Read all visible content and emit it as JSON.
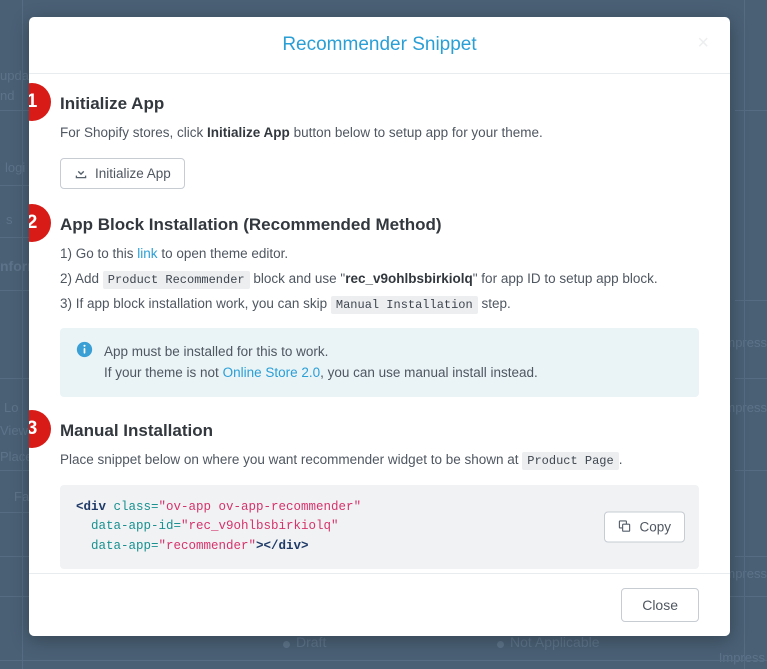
{
  "background": {
    "status_draft": "Draft",
    "status_not_applicable": "Not Applicable",
    "fragments": [
      "upda",
      "nd",
      "logi",
      "s",
      "nform",
      "Lo",
      "View",
      "Place",
      "Fa",
      "licable"
    ],
    "right_fragments": [
      "mpress",
      "mpress",
      "mpress",
      "Impress"
    ]
  },
  "modal": {
    "title": "Recommender Snippet",
    "close_icon": "×",
    "footer": {
      "close_label": "Close"
    },
    "sections": [
      {
        "badge": "1",
        "title": "Initialize App",
        "desc_before": "For Shopify stores, click ",
        "desc_bold": "Initialize App",
        "desc_after": " button below to setup app for your theme.",
        "button_label": "Initialize App",
        "button_icon": "download-icon"
      },
      {
        "badge": "2",
        "title": "App Block Installation (Recommended Method)",
        "step1_before": "1) Go to this ",
        "step1_link": "link",
        "step1_after": " to open theme editor.",
        "step2_before": "2) Add ",
        "step2_chip": "Product Recommender",
        "step2_middle": " block and use \"",
        "step2_appid": "rec_v9ohlbsbirkiolq",
        "step2_after": "\" for app ID to setup app block.",
        "step3_before": "3) If app block installation work, you can skip ",
        "step3_chip": "Manual Installation",
        "step3_after": " step.",
        "alert": {
          "icon": "info-icon",
          "line1": "App must be installed for this to work.",
          "line2_before": "If your theme is not ",
          "line2_link": "Online Store 2.0",
          "line2_after": ", you can use manual install instead."
        }
      },
      {
        "badge": "3",
        "title": "Manual Installation",
        "desc_before": "Place snippet below on where you want recommender widget to be shown at ",
        "desc_chip": "Product Page",
        "desc_after": ".",
        "copy_label": "Copy",
        "copy_icon": "copy-icon",
        "code": {
          "line1_tag": "<div",
          "line1_attr": " class=",
          "line1_str": "\"ov-app ov-app-recommender\"",
          "line2_attr": "  data-app-id=",
          "line2_str": "\"rec_v9ohlbsbirkiolq\"",
          "line3_attr": "  data-app=",
          "line3_str": "\"recommender\"",
          "line3_close": "></div>"
        }
      }
    ]
  },
  "colors": {
    "accent": "#2a9fd6",
    "badge": "#d81b16",
    "backdrop": "#4a6075",
    "alert_bg": "#eaf3f6",
    "code_bg": "#f0f2f3"
  }
}
